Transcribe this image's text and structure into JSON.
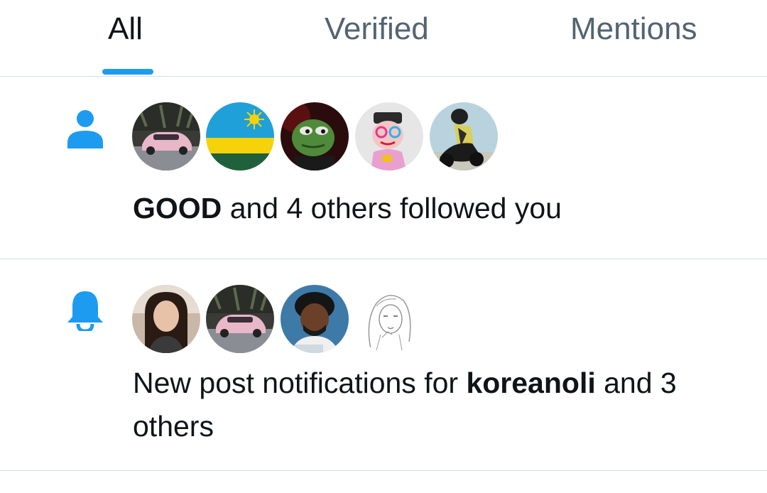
{
  "tabs": [
    {
      "label": "All",
      "active": true
    },
    {
      "label": "Verified",
      "active": false
    },
    {
      "label": "Mentions",
      "active": false
    }
  ],
  "notifications": [
    {
      "type": "follow",
      "icon": "person-icon",
      "avatars": [
        "avatar-pink-car",
        "avatar-flag",
        "avatar-frog",
        "avatar-colorful-character",
        "avatar-motorcycle"
      ],
      "actor": "GOOD",
      "message": " and 4 others followed you"
    },
    {
      "type": "post-notifications",
      "icon": "bell-icon",
      "avatars": [
        "avatar-woman",
        "avatar-pink-car",
        "avatar-man-curly-hair",
        "avatar-sketch-girl"
      ],
      "prefix": "New post notifications for ",
      "actor": "koreanoli",
      "suffix": " and 3 others"
    }
  ],
  "colors": {
    "accent": "#1d9bf0",
    "text_primary": "#0f1419",
    "text_secondary": "#536471",
    "divider": "#d6dde1"
  }
}
